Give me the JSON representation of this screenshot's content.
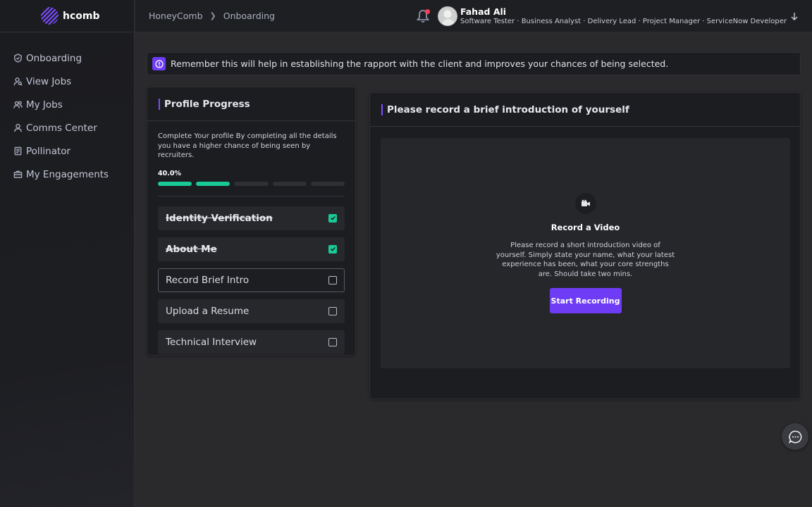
{
  "brand": {
    "name": "hcomb"
  },
  "sidebar": {
    "items": [
      {
        "label": "Onboarding",
        "icon": "badge-icon"
      },
      {
        "label": "View Jobs",
        "icon": "user-search-icon"
      },
      {
        "label": "My Jobs",
        "icon": "users-icon"
      },
      {
        "label": "Comms Center",
        "icon": "user-icon"
      },
      {
        "label": "Pollinator",
        "icon": "document-icon"
      },
      {
        "label": "My Engagements",
        "icon": "briefcase-icon"
      }
    ]
  },
  "header": {
    "breadcrumb": [
      "HoneyComb",
      "Onboarding"
    ],
    "user_name": "Fahad Ali",
    "user_roles": "Software Tester · Business Analyst · Delivery Lead · Project Manager · ServiceNow Developer"
  },
  "banner": {
    "text": "Remember this will help in establishing the rapport with the client and improves your chances of being selected."
  },
  "profile_progress": {
    "title": "Profile Progress",
    "description": "Complete Your profile By completing all the details you have a higher chance of being seen by recruiters.",
    "percent_label": "40.0%",
    "percent": 40,
    "segments_done": 2,
    "segments_total": 5,
    "steps": [
      {
        "label": "Identity Verification",
        "done": true
      },
      {
        "label": "About Me",
        "done": true
      },
      {
        "label": "Record Brief Intro",
        "done": false,
        "active": true
      },
      {
        "label": "Upload a Resume",
        "done": false
      },
      {
        "label": "Technical Interview",
        "done": false
      }
    ]
  },
  "intro": {
    "title": "Please record a brief introduction of yourself",
    "video_title": "Record a Video",
    "video_desc": "Please record a short introduction video of yourself. Simply state your name, what your latest experience has been, what your core strengths are. Should take two mins.",
    "button_label": "Start Recording"
  },
  "colors": {
    "accent": "#6d3cf4",
    "success": "#19c997",
    "alert": "#ff3b5c"
  }
}
